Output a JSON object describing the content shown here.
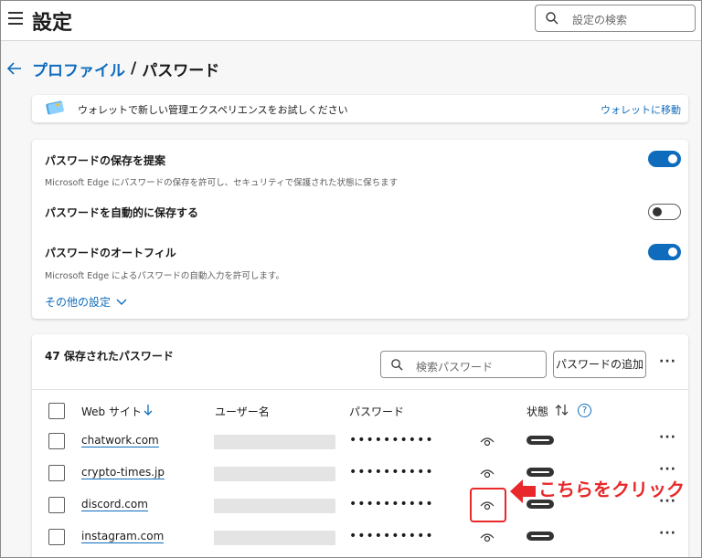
{
  "header": {
    "title": "設定",
    "search_placeholder": "設定の検索"
  },
  "breadcrumb": {
    "parent": "プロファイル",
    "separator": "/",
    "current": "パスワード"
  },
  "wallet_banner": {
    "text": "ウォレットで新しい管理エクスペリエンスをお試しください",
    "link": "ウォレットに移動"
  },
  "settings": {
    "offer_save": {
      "title": "パスワードの保存を提案",
      "desc": "Microsoft Edge にパスワードの保存を許可し、セキュリティで保護された状態に保ちます",
      "enabled": true
    },
    "auto_save": {
      "title": "パスワードを自動的に保存する",
      "enabled": false
    },
    "autofill": {
      "title": "パスワードのオートフィル",
      "desc": "Microsoft Edge によるパスワードの自動入力を許可します。",
      "enabled": true
    },
    "more_label": "その他の設定"
  },
  "passwords": {
    "count_label": "47 保存されたパスワード",
    "search_placeholder": "検索パスワード",
    "add_label": "パスワードの追加",
    "columns": {
      "website": "Web サイト",
      "username": "ユーザー名",
      "password": "パスワード",
      "status": "状態"
    },
    "rows": [
      {
        "site": "chatwork.com",
        "password": "••••••••••"
      },
      {
        "site": "crypto-times.jp",
        "password": "••••••••••"
      },
      {
        "site": "discord.com",
        "password": "••••••••••"
      },
      {
        "site": "instagram.com",
        "password": "••••••••••"
      }
    ]
  },
  "annotation": {
    "text": "こちらをクリック"
  },
  "colors": {
    "accent": "#0f6cbd",
    "annotation": "#e8282b"
  },
  "icons": [
    "hamburger-icon",
    "search-icon",
    "back-arrow-icon",
    "wallet-card-icon",
    "chevron-down-icon",
    "sort-down-icon",
    "sort-updown-icon",
    "help-icon",
    "eye-icon",
    "more-icon",
    "status-icon"
  ]
}
